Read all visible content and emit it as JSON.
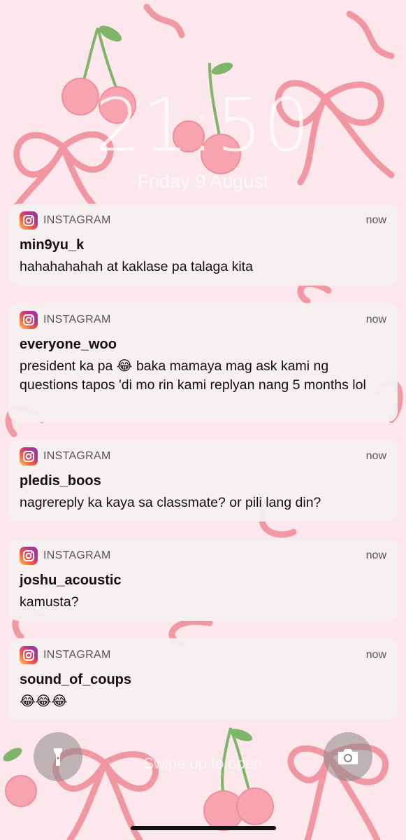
{
  "lockscreen": {
    "time": "21:50",
    "date": "Friday 9 August",
    "swipe_hint": "Swipe up to open"
  },
  "notifications": [
    {
      "app": "INSTAGRAM",
      "time": "now",
      "sender": "min9yu_k",
      "message": "hahahahahah at kaklase pa talaga kita"
    },
    {
      "app": "INSTAGRAM",
      "time": "now",
      "sender": "everyone_woo",
      "message": "president ka pa 😂 baka mamaya mag ask kami ng questions tapos 'di mo rin kami replyan nang 5 months lol"
    },
    {
      "app": "INSTAGRAM",
      "time": "now",
      "sender": "pledis_boos",
      "message": "nagrereply ka kaya sa classmate? or pili lang din?"
    },
    {
      "app": "INSTAGRAM",
      "time": "now",
      "sender": "joshu_acoustic",
      "message": "kamusta?"
    },
    {
      "app": "INSTAGRAM",
      "time": "now",
      "sender": "sound_of_coups",
      "message": "😂😂😂"
    }
  ],
  "icons": {
    "app": "instagram-icon",
    "left_button": "flashlight-icon",
    "right_button": "camera-icon"
  },
  "colors": {
    "wallpaper": "#fbe7ec",
    "ribbon": "#ef8f9a",
    "cherry": "#f7a3b0",
    "stem": "#7fb56a",
    "card": "#f5f0f1"
  }
}
